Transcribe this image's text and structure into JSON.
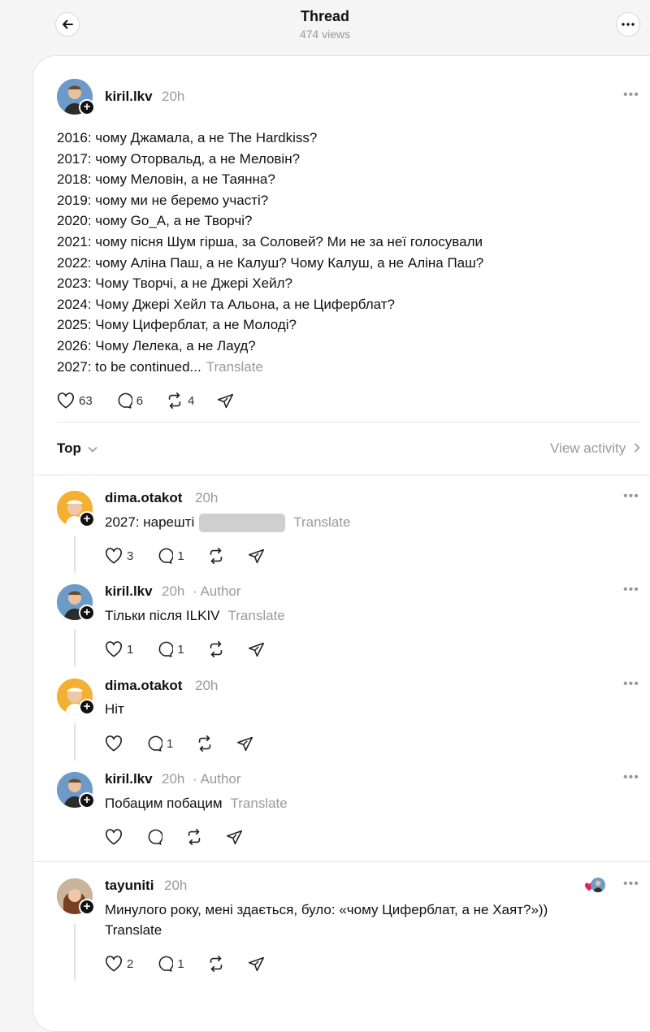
{
  "header": {
    "title": "Thread",
    "views": "474 views"
  },
  "post": {
    "username": "kiril.lkv",
    "time": "20h",
    "lines": [
      "2016: чому Джамала, а не The Hardkiss?",
      "2017: чому Оторвальд, а не Меловін?",
      "2018: чому Меловін, а не Таянна?",
      "2019: чому ми не беремо участі?",
      "2020: чому Go_A, а не Творчі?",
      "2021: чому пісня Шум гірша, за Соловей? Ми не за неї голосували",
      "2022: чому Аліна Паш, а не Калуш? Чому Калуш, а не Аліна Паш?",
      "2023: Чому Творчі, а не Джері Хейл?",
      "2024: Чому Джері Хейл та Альона, а не Циферблат?",
      "2025: Чому Циферблат, а не Молоді?",
      "2026: Чому Лелека, а не Лауд?",
      "2027: to be continued..."
    ],
    "translate": "Translate",
    "likes": "63",
    "replies": "6",
    "reposts": "4"
  },
  "sort": {
    "label": "Top",
    "view_activity": "View activity"
  },
  "replies": [
    {
      "username": "dima.otakot",
      "time": "20h",
      "author": "",
      "text": "2027: нарешті",
      "translate": "Translate",
      "likes": "3",
      "comments": "1"
    },
    {
      "username": "kiril.lkv",
      "time": "20h",
      "author": "· Author",
      "text": "Тільки після ILKIV",
      "translate": "Translate",
      "likes": "1",
      "comments": "1"
    },
    {
      "username": "dima.otakot",
      "time": "20h",
      "author": "",
      "text": "Ніт",
      "translate": "",
      "likes": "",
      "comments": "1"
    },
    {
      "username": "kiril.lkv",
      "time": "20h",
      "author": "· Author",
      "text": "Побацим побацим",
      "translate": "Translate",
      "likes": "",
      "comments": ""
    },
    {
      "username": "tayuniti",
      "time": "20h",
      "author": "",
      "text": "Минулого року, мені здається, було: «чому Циферблат, а не Хаят?»))",
      "translate": "Translate",
      "likes": "2",
      "comments": "1"
    }
  ],
  "colors": {
    "accent": "#111111",
    "muted": "#9a9a9a",
    "heart": "#e0245e",
    "avatar_kiril": "#4a7fb5",
    "avatar_dima": "#f2a91e",
    "avatar_tayuniti": "#8a5a3b"
  }
}
